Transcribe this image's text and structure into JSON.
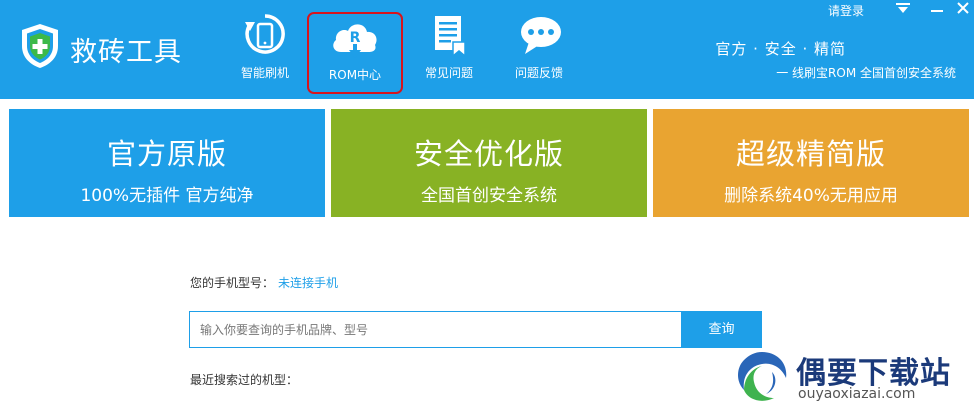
{
  "app": {
    "title": "救砖工具"
  },
  "nav": [
    {
      "label": "智能刷机",
      "icon": "phone-refresh-icon"
    },
    {
      "label": "ROM中心",
      "icon": "cloud-rom-icon",
      "active": true
    },
    {
      "label": "常见问题",
      "icon": "document-icon"
    },
    {
      "label": "问题反馈",
      "icon": "chat-bubble-icon"
    }
  ],
  "topbar": {
    "login": "请登录"
  },
  "slogan": {
    "line1": "官方 · 安全 · 精简",
    "line2": "一 线刷宝ROM 全国首创安全系统"
  },
  "tiles": [
    {
      "title": "官方原版",
      "subtitle": "100%无插件 官方纯净",
      "color": "#1e9fe8"
    },
    {
      "title": "安全优化版",
      "subtitle": "全国首创安全系统",
      "color": "#88b224"
    },
    {
      "title": "超级精简版",
      "subtitle": "删除系统40%无用应用",
      "color": "#e9a431"
    }
  ],
  "search": {
    "model_label": "您的手机型号：",
    "model_value": "未连接手机",
    "placeholder": "输入你要查询的手机品牌、型号",
    "button": "查询",
    "recent_label": "最近搜索过的机型："
  },
  "watermark": {
    "name": "偶要下载站",
    "url": "ouyaoxiazai.com"
  },
  "colors": {
    "brand_blue": "#1e9fe8",
    "green": "#88b224",
    "orange": "#e9a431",
    "highlight_red": "#d8141c"
  }
}
